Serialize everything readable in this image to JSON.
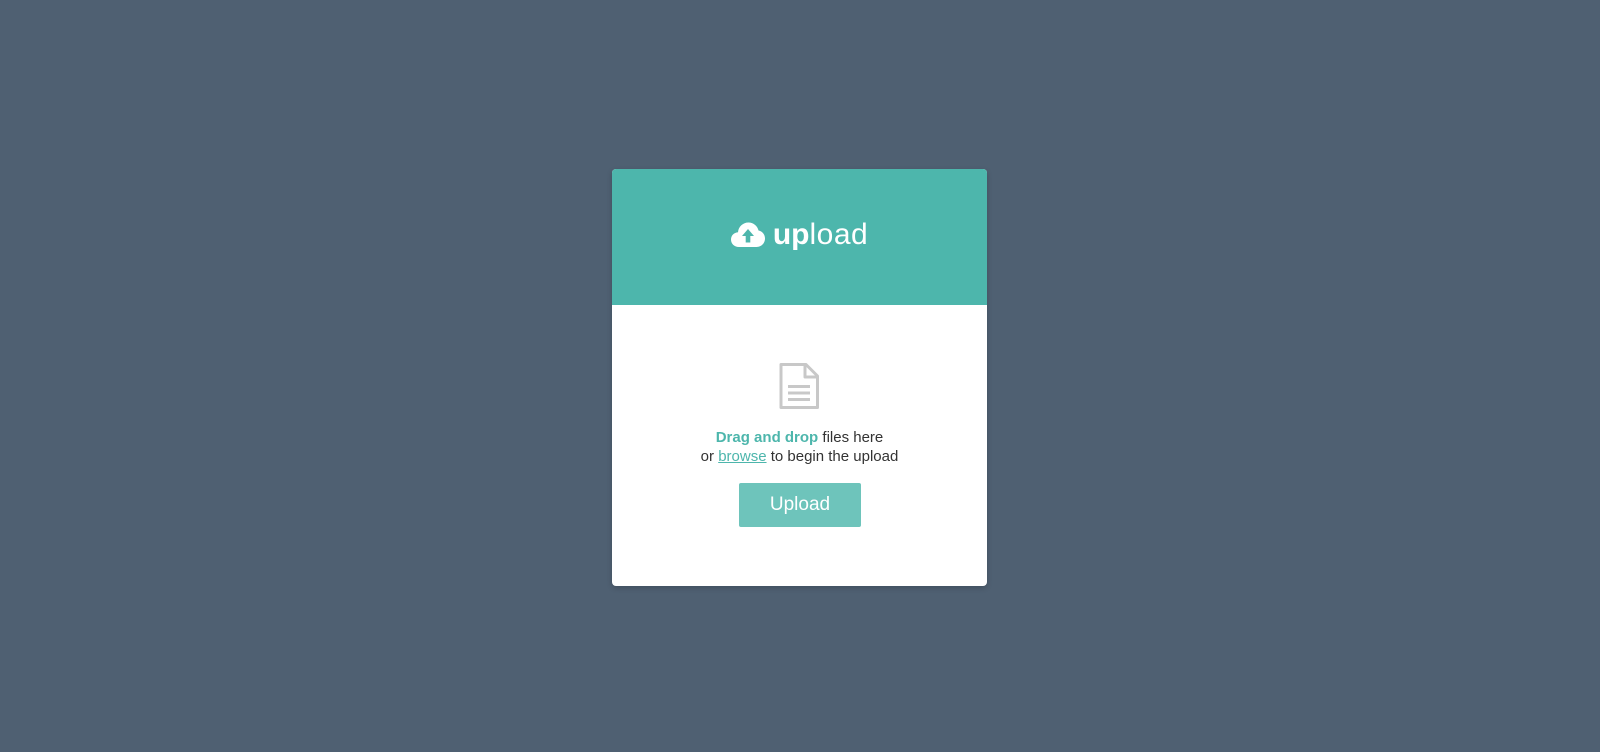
{
  "brand": {
    "icon": "cloud-upload-icon",
    "bold": "up",
    "light": "load"
  },
  "dropzone": {
    "icon": "file-icon",
    "line1_accent": "Drag and drop",
    "line1_rest": " files here",
    "line2_prefix": "or ",
    "browse_label": "browse",
    "line2_suffix": " to begin the upload"
  },
  "upload_button": {
    "label": "Upload"
  },
  "colors": {
    "background": "#4f6072",
    "accent": "#4db6ac",
    "button": "#6ec4bb",
    "card": "#ffffff",
    "icon_gray": "#c8c8c8"
  }
}
